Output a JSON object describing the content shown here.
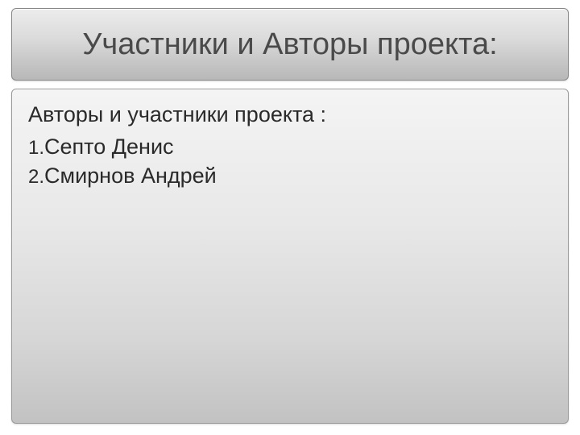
{
  "title": "Участники и Авторы проекта:",
  "subtitle": "Авторы и участники проекта :",
  "items": [
    {
      "num": "1.",
      "name": "Септо Денис"
    },
    {
      "num": "2.",
      "name": "Смирнов Андрей"
    }
  ]
}
